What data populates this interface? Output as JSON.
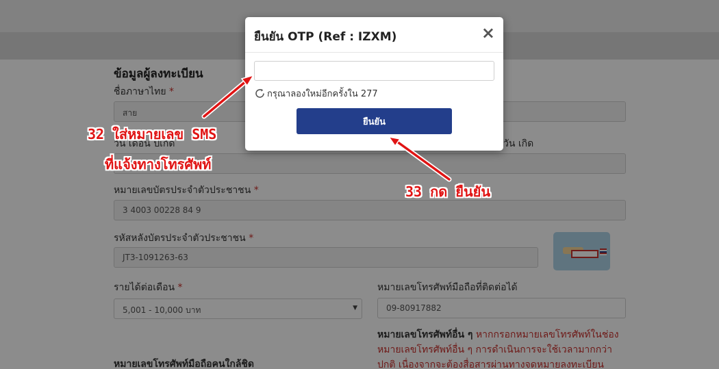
{
  "form": {
    "section_title": "ข้อมูลผู้ลงทะเบียน",
    "required_mark": "*",
    "thai_name_label": "ชื่อภาษาไทย",
    "thai_name_value": "สาย",
    "birthdate_label_left": "วัน เดือน ปีเกิด",
    "birthdate_label_right": "วัน เกิด",
    "id_card_label": "หมายเลขบัตรประจำตัวประชาชน",
    "id_card_value": "3 4003 00228 84 9",
    "laser_code_label": "รหัสหลังบัตรประจำตัวประชาชน",
    "laser_code_value": "JT3-1091263-63",
    "income_label": "รายได้ต่อเดือน",
    "income_value": "5,001 - 10,000 บาท",
    "mobile_label": "หมายเลขโทรศัพท์มือถือที่ติดต่อได้",
    "mobile_value": "09-80917882",
    "other_phone_label": "หมายเลขโทรศัพท์อื่น ๆ",
    "other_phone_note_1": "หากกรอกหมายเลขโทรศัพท์ในช่อง",
    "other_phone_note_2": "หมายเลขโทรศัพท์อื่น ๆ การดำเนินการจะใช้เวลามากกว่า",
    "other_phone_note_3": "ปกติ เนื่องจากจะต้องสื่อสารผ่านทางจดหมายลงทะเบียน",
    "relative_phone_label": "หมายเลขโทรศัพท์มือถือคนใกล้ชิด"
  },
  "modal": {
    "title": "ยืนยัน OTP (Ref : IZXM)",
    "close_symbol": "×",
    "otp_value": "",
    "resend_text": "กรุณาลองใหม่อีกครั้งใน 277",
    "confirm_label": "ยืนยัน"
  },
  "annotations": {
    "step32_line1": "32 ใส่หมายเลข SMS",
    "step32_line2": "ที่แจ้งทางโทรศัพท์",
    "step33": "33 กด ยืนยัน"
  },
  "icons": {
    "refresh": "refresh-icon",
    "close": "close-icon",
    "card": "id-card-back-icon"
  },
  "colors": {
    "primary_button": "#233e8b",
    "annotation": "#e01414",
    "required": "#c9302c"
  }
}
